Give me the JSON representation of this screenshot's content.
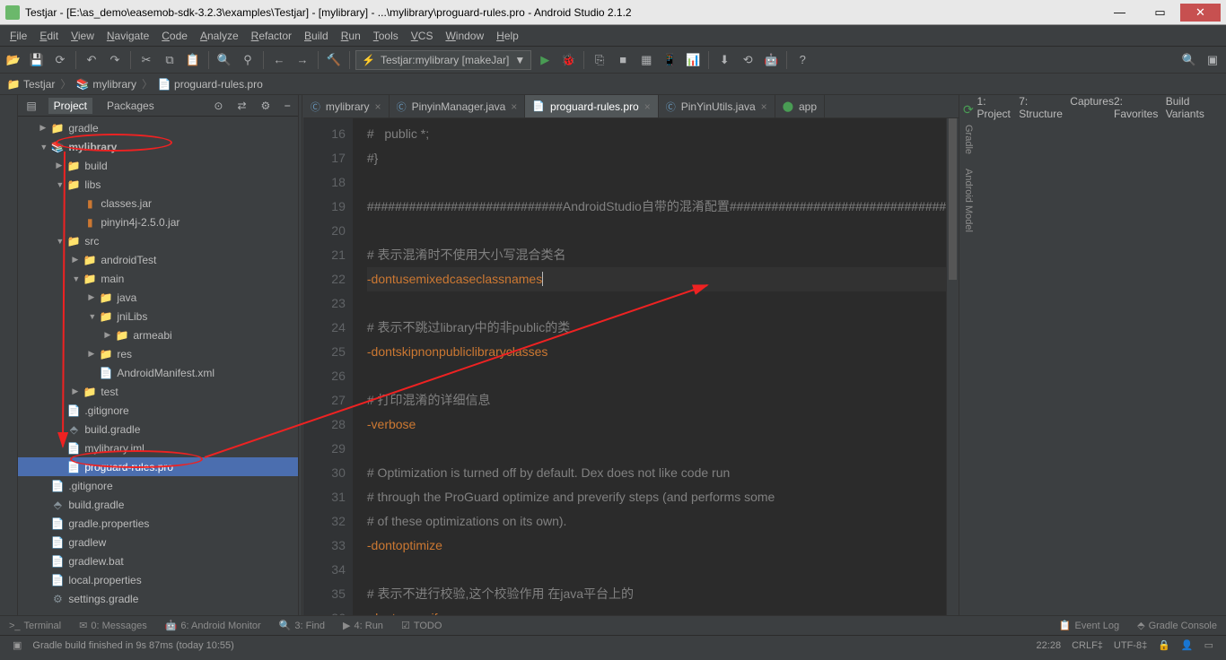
{
  "window": {
    "title": "Testjar - [E:\\as_demo\\easemob-sdk-3.2.3\\examples\\Testjar] - [mylibrary] - ...\\mylibrary\\proguard-rules.pro - Android Studio 2.1.2",
    "min": "—",
    "max": "▭",
    "close": "✕"
  },
  "menu": [
    "File",
    "Edit",
    "View",
    "Navigate",
    "Code",
    "Analyze",
    "Refactor",
    "Build",
    "Run",
    "Tools",
    "VCS",
    "Window",
    "Help"
  ],
  "runConfig": {
    "label": "Testjar:mylibrary [makeJar]",
    "arrow": "▼"
  },
  "breadcrumb": [
    {
      "icon": "📁",
      "label": "Testjar"
    },
    {
      "icon": "📚",
      "label": "mylibrary"
    },
    {
      "icon": "📄",
      "label": "proguard-rules.pro"
    }
  ],
  "leftTabs": [
    "1: Project",
    "7: Structure",
    "Captures",
    "2: Favorites",
    "Build Variants"
  ],
  "rightTabs": [
    "Gradle",
    "Android Model"
  ],
  "projectHeader": {
    "tabs": [
      "Project",
      "Packages"
    ],
    "gear": "⚙"
  },
  "tree": [
    {
      "d": 1,
      "arrow": "▶",
      "icon": "📁",
      "cls": "folder",
      "label": "gradle"
    },
    {
      "d": 1,
      "arrow": "▼",
      "icon": "📚",
      "cls": "folder",
      "label": "mylibrary",
      "bold": true,
      "anno": "ell-1"
    },
    {
      "d": 2,
      "arrow": "▶",
      "icon": "📁",
      "cls": "folder",
      "label": "build"
    },
    {
      "d": 2,
      "arrow": "▼",
      "icon": "📁",
      "cls": "folder",
      "label": "libs"
    },
    {
      "d": 3,
      "arrow": "",
      "icon": "▮",
      "cls": "jar-icon",
      "label": "classes.jar"
    },
    {
      "d": 3,
      "arrow": "",
      "icon": "▮",
      "cls": "jar-icon",
      "label": "pinyin4j-2.5.0.jar"
    },
    {
      "d": 2,
      "arrow": "▼",
      "icon": "📁",
      "cls": "folder",
      "label": "src"
    },
    {
      "d": 3,
      "arrow": "▶",
      "icon": "📁",
      "cls": "folder",
      "label": "androidTest"
    },
    {
      "d": 3,
      "arrow": "▼",
      "icon": "📁",
      "cls": "folder",
      "label": "main"
    },
    {
      "d": 4,
      "arrow": "▶",
      "icon": "📁",
      "cls": "folder-blue",
      "label": "java"
    },
    {
      "d": 4,
      "arrow": "▼",
      "icon": "📁",
      "cls": "folder-blue",
      "label": "jniLibs"
    },
    {
      "d": 5,
      "arrow": "▶",
      "icon": "📁",
      "cls": "folder",
      "label": "armeabi"
    },
    {
      "d": 4,
      "arrow": "▶",
      "icon": "📁",
      "cls": "folder-blue",
      "label": "res"
    },
    {
      "d": 4,
      "arrow": "",
      "icon": "📄",
      "cls": "file-icon",
      "label": "AndroidManifest.xml"
    },
    {
      "d": 3,
      "arrow": "▶",
      "icon": "📁",
      "cls": "folder",
      "label": "test"
    },
    {
      "d": 2,
      "arrow": "",
      "icon": "📄",
      "cls": "file-icon",
      "label": ".gitignore"
    },
    {
      "d": 2,
      "arrow": "",
      "icon": "⬘",
      "cls": "gradle-icon",
      "label": "build.gradle"
    },
    {
      "d": 2,
      "arrow": "",
      "icon": "📄",
      "cls": "file-icon",
      "label": "mylibrary.iml"
    },
    {
      "d": 2,
      "arrow": "",
      "icon": "📄",
      "cls": "file-icon",
      "label": "proguard-rules.pro",
      "selected": true,
      "anno": "ell-2"
    },
    {
      "d": 1,
      "arrow": "",
      "icon": "📄",
      "cls": "file-icon",
      "label": ".gitignore"
    },
    {
      "d": 1,
      "arrow": "",
      "icon": "⬘",
      "cls": "gradle-icon",
      "label": "build.gradle"
    },
    {
      "d": 1,
      "arrow": "",
      "icon": "📄",
      "cls": "file-icon",
      "label": "gradle.properties"
    },
    {
      "d": 1,
      "arrow": "",
      "icon": "📄",
      "cls": "file-icon",
      "label": "gradlew"
    },
    {
      "d": 1,
      "arrow": "",
      "icon": "📄",
      "cls": "file-icon",
      "label": "gradlew.bat"
    },
    {
      "d": 1,
      "arrow": "",
      "icon": "📄",
      "cls": "file-icon",
      "label": "local.properties"
    },
    {
      "d": 1,
      "arrow": "",
      "icon": "⚙",
      "cls": "gradle-icon",
      "label": "settings.gradle"
    }
  ],
  "editorTabs": [
    {
      "icon": "Ⓒ",
      "cls": "ed-c",
      "label": "mylibrary",
      "close": "×"
    },
    {
      "icon": "Ⓒ",
      "cls": "ed-c",
      "label": "PinyinManager.java",
      "close": "×"
    },
    {
      "icon": "📄",
      "cls": "ed-f",
      "label": "proguard-rules.pro",
      "close": "×",
      "active": true
    },
    {
      "icon": "Ⓒ",
      "cls": "ed-c",
      "label": "PinYinUtils.java",
      "close": "×"
    },
    {
      "icon": "⬤",
      "cls": "ed-a",
      "label": "app",
      "close": ""
    }
  ],
  "code": {
    "start": 16,
    "lines": [
      {
        "cls": "comment",
        "text": "#   public *;"
      },
      {
        "cls": "comment",
        "text": "#}"
      },
      {
        "cls": "",
        "text": ""
      },
      {
        "cls": "comment",
        "text": "############################AndroidStudio自带的混淆配置###############################"
      },
      {
        "cls": "",
        "text": ""
      },
      {
        "cls": "comment",
        "text": "# 表示混淆时不使用大小写混合类名"
      },
      {
        "cls": "kw",
        "text": "-dontusemixedcaseclassnames",
        "caret": true
      },
      {
        "cls": "",
        "text": ""
      },
      {
        "cls": "comment",
        "text": "# 表示不跳过library中的非public的类"
      },
      {
        "cls": "kw",
        "text": "-dontskipnonpubliclibraryclasses"
      },
      {
        "cls": "",
        "text": ""
      },
      {
        "cls": "comment",
        "text": "# 打印混淆的详细信息"
      },
      {
        "cls": "kw",
        "text": "-verbose"
      },
      {
        "cls": "",
        "text": ""
      },
      {
        "cls": "comment",
        "text": "# Optimization is turned off by default. Dex does not like code run"
      },
      {
        "cls": "comment",
        "text": "# through the ProGuard optimize and preverify steps (and performs some"
      },
      {
        "cls": "comment",
        "text": "# of these optimizations on its own)."
      },
      {
        "cls": "kw",
        "text": "-dontoptimize"
      },
      {
        "cls": "",
        "text": ""
      },
      {
        "cls": "comment",
        "text": "# 表示不进行校验,这个校验作用 在java平台上的"
      },
      {
        "cls": "kw",
        "text": "-dontpreverify"
      }
    ]
  },
  "bottomTabs": {
    "left": [
      {
        "icon": ">_",
        "label": "Terminal"
      },
      {
        "icon": "✉",
        "label": "0: Messages"
      },
      {
        "icon": "🤖",
        "label": "6: Android Monitor"
      },
      {
        "icon": "🔍",
        "label": "3: Find"
      },
      {
        "icon": "▶",
        "label": "4: Run"
      },
      {
        "icon": "☑",
        "label": "TODO"
      }
    ],
    "right": [
      {
        "icon": "📋",
        "label": "Event Log"
      },
      {
        "icon": "⬘",
        "label": "Gradle Console"
      }
    ]
  },
  "status": {
    "message": "Gradle build finished in 9s 87ms (today 10:55)",
    "time": "22:28",
    "linesep": "CRLF‡",
    "encoding": "UTF-8‡",
    "lock": "🔒"
  }
}
